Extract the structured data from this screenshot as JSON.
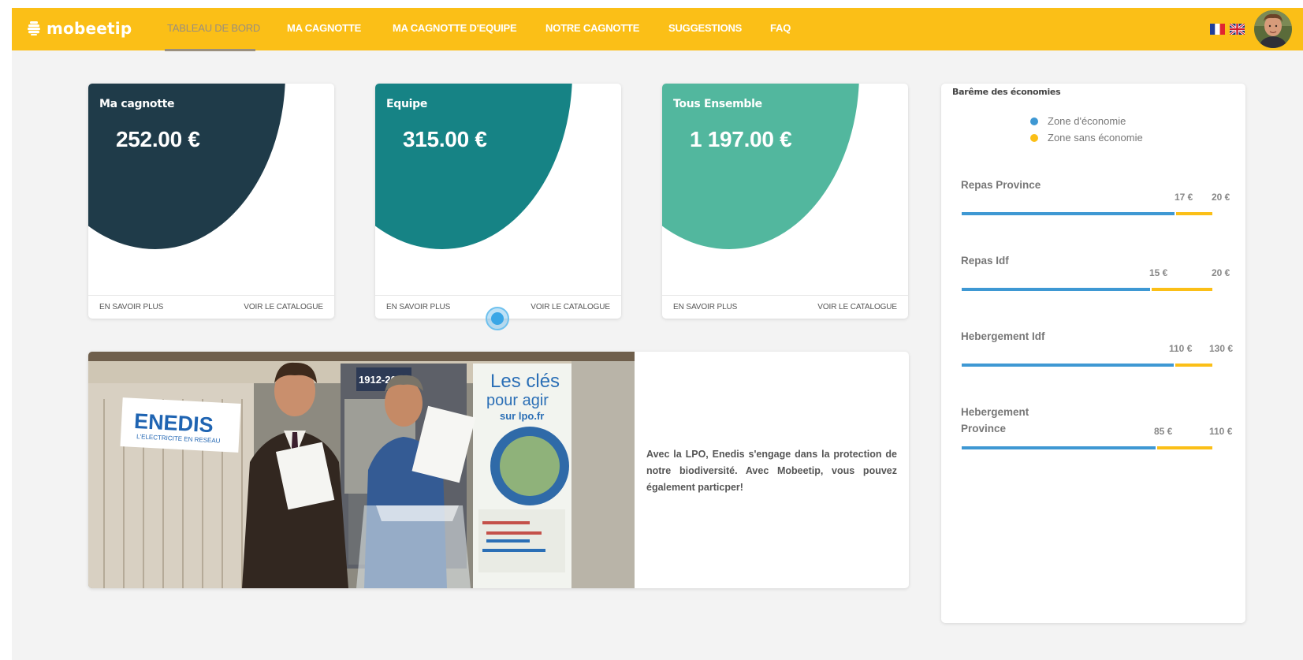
{
  "brand": {
    "name": "mobeetip"
  },
  "nav": [
    {
      "label": "TABLEAU DE BORD"
    },
    {
      "label": "MA CAGNOTTE"
    },
    {
      "label": "MA CAGNOTTE D'EQUIPE"
    },
    {
      "label": "NOTRE CAGNOTTE"
    },
    {
      "label": "SUGGESTIONS"
    },
    {
      "label": "FAQ"
    }
  ],
  "cards": [
    {
      "title": "Ma cagnotte",
      "amount": "252.00 €",
      "color": "#1f3b49",
      "learn_more": "EN SAVOIR PLUS",
      "catalogue": "VOIR LE CATALOGUE"
    },
    {
      "title": "Equipe",
      "amount": "315.00 €",
      "color": "#168385",
      "learn_more": "EN SAVOIR PLUS",
      "catalogue": "VOIR LE CATALOGUE"
    },
    {
      "title": "Tous Ensemble",
      "amount": "1 197.00 €",
      "color": "#52b79e",
      "learn_more": "EN SAVOIR PLUS",
      "catalogue": "VOIR LE CATALOGUE"
    }
  ],
  "news": {
    "text": "Avec la LPO, Enedis s'engage dans la protection de notre biodiversité. Avec Mobeetip, vous pouvez également particper!",
    "photo_texts": {
      "banner_logo": "ENEDIS",
      "banner_tagline": "L'ELECTRICITE EN RESEAU",
      "poster_title": "Les clés",
      "poster_line2": "pour agir",
      "poster_sub": "sur lpo.fr",
      "poster_year": "1912-2012"
    }
  },
  "bareme": {
    "title": "Barême des économies",
    "legend": [
      {
        "label": "Zone d'économie",
        "color": "#3e98d3"
      },
      {
        "label": "Zone sans économie",
        "color": "#fbbf17"
      }
    ],
    "rates": [
      {
        "label": "Repas Province",
        "eco": "17 €",
        "max": "20 €",
        "eco_value": 17,
        "max_value": 20
      },
      {
        "label": "Repas Idf",
        "eco": "15 €",
        "max": "20 €",
        "eco_value": 15,
        "max_value": 20
      },
      {
        "label": "Hebergement Idf",
        "eco": "110 €",
        "max": "130 €",
        "eco_value": 110,
        "max_value": 130
      },
      {
        "label": "Hebergement Province",
        "eco": "85 €",
        "max": "110 €",
        "eco_value": 85,
        "max_value": 110
      }
    ]
  },
  "colors": {
    "accent": "#fbbf17",
    "economy": "#3e98d3"
  },
  "icons": [
    "beehive-icon",
    "french-flag-icon",
    "uk-flag-icon",
    "user-avatar"
  ]
}
